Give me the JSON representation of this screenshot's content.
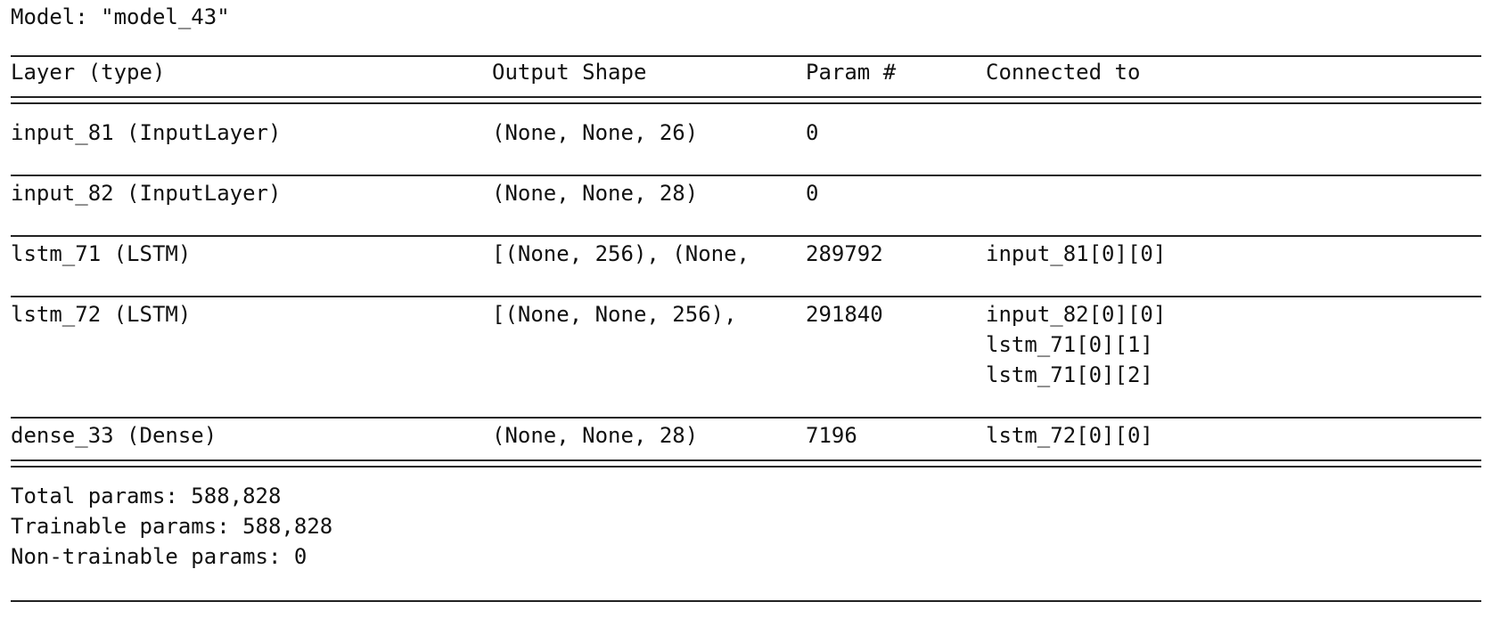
{
  "model_title": "Model: \"model_43\"",
  "headers": {
    "layer": "Layer (type)",
    "output_shape": "Output Shape",
    "param": "Param #",
    "connected": "Connected to"
  },
  "rows": [
    {
      "layer": "input_81 (InputLayer)",
      "output_shape": "(None, None, 26)",
      "param": "0",
      "connected": []
    },
    {
      "layer": "input_82 (InputLayer)",
      "output_shape": "(None, None, 28)",
      "param": "0",
      "connected": []
    },
    {
      "layer": "lstm_71 (LSTM)",
      "output_shape": "[(None, 256), (None,",
      "param": "289792",
      "connected": [
        "input_81[0][0]"
      ]
    },
    {
      "layer": "lstm_72 (LSTM)",
      "output_shape": "[(None, None, 256),",
      "param": "291840",
      "connected": [
        "input_82[0][0]",
        "lstm_71[0][1]",
        "lstm_71[0][2]"
      ]
    },
    {
      "layer": "dense_33 (Dense)",
      "output_shape": "(None, None, 28)",
      "param": "7196",
      "connected": [
        "lstm_72[0][0]"
      ]
    }
  ],
  "totals": {
    "total": "Total params: 588,828",
    "trainable": "Trainable params: 588,828",
    "non_trainable": "Non-trainable params: 0"
  }
}
